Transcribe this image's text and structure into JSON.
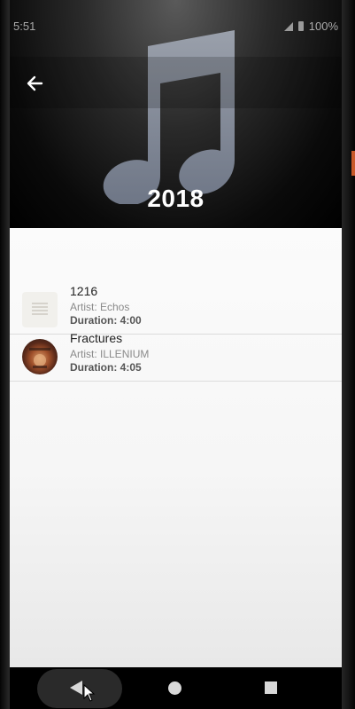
{
  "status_bar": {
    "time": "5:51",
    "battery": "100%"
  },
  "header": {
    "back_icon": "arrow-left-icon",
    "art_icon": "music-note-icon",
    "title": "2018"
  },
  "songs": [
    {
      "title": "1216",
      "artist": "Artist: Echos",
      "duration": "Duration: 4:00",
      "thumb": "placeholder-document-icon"
    },
    {
      "title": "Fractures",
      "artist": "Artist: ILLENIUM",
      "duration": "Duration: 4:05",
      "thumb": "album-art"
    }
  ],
  "nav": {
    "back_icon": "triangle-back-icon",
    "home_icon": "circle-home-icon",
    "recents_icon": "square-recents-icon"
  },
  "colors": {
    "header_bg": "#000000",
    "list_bg": "#fbfbfb",
    "title_text": "#ffffff",
    "song_title": "#222222",
    "artist_text": "#8a8a8a"
  }
}
